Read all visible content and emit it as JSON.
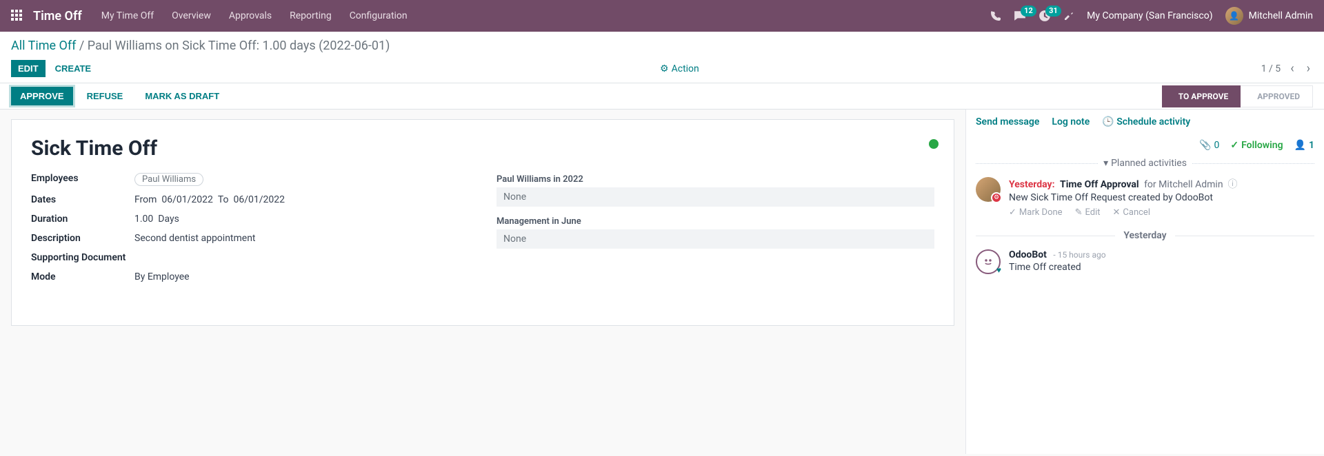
{
  "nav": {
    "brand": "Time Off",
    "links": [
      "My Time Off",
      "Overview",
      "Approvals",
      "Reporting",
      "Configuration"
    ],
    "msg_badge": "12",
    "activity_badge": "31",
    "company": "My Company (San Francisco)",
    "user": "Mitchell Admin"
  },
  "breadcrumb": {
    "root": "All Time Off",
    "current": "Paul Williams on Sick Time Off: 1.00 days (2022-06-01)"
  },
  "controls": {
    "edit": "EDIT",
    "create": "CREATE",
    "action": "Action",
    "pager": "1 / 5"
  },
  "statusbar": {
    "approve": "APPROVE",
    "refuse": "REFUSE",
    "draft": "MARK AS DRAFT",
    "stage_active": "TO APPROVE",
    "stage_next": "APPROVED"
  },
  "form": {
    "title": "Sick Time Off",
    "labels": {
      "employees": "Employees",
      "dates": "Dates",
      "duration": "Duration",
      "description": "Description",
      "supporting": "Supporting Document",
      "mode": "Mode"
    },
    "values": {
      "employee_tag": "Paul Williams",
      "dates_from_label": "From",
      "dates_from": "06/01/2022",
      "dates_to_label": "To",
      "dates_to": "06/01/2022",
      "duration_num": "1.00",
      "duration_unit": "Days",
      "description": "Second dentist appointment",
      "mode": "By Employee"
    },
    "panels": {
      "p1_label": "Paul Williams in 2022",
      "p1_value": "None",
      "p2_label": "Management in June",
      "p2_value": "None"
    }
  },
  "chatter": {
    "send": "Send message",
    "log": "Log note",
    "schedule": "Schedule activity",
    "attach_count": "0",
    "following": "Following",
    "followers_count": "1",
    "planned_header": "Planned activities",
    "activity": {
      "due": "Yesterday:",
      "title": "Time Off Approval",
      "for_label": "for",
      "for_user": "Mitchell Admin",
      "line2": "New Sick Time Off Request created by OdooBot",
      "mark_done": "Mark Done",
      "edit": "Edit",
      "cancel": "Cancel"
    },
    "msg_sep": "Yesterday",
    "message": {
      "author": "OdooBot",
      "time": "- 15 hours ago",
      "text": "Time Off created"
    }
  }
}
